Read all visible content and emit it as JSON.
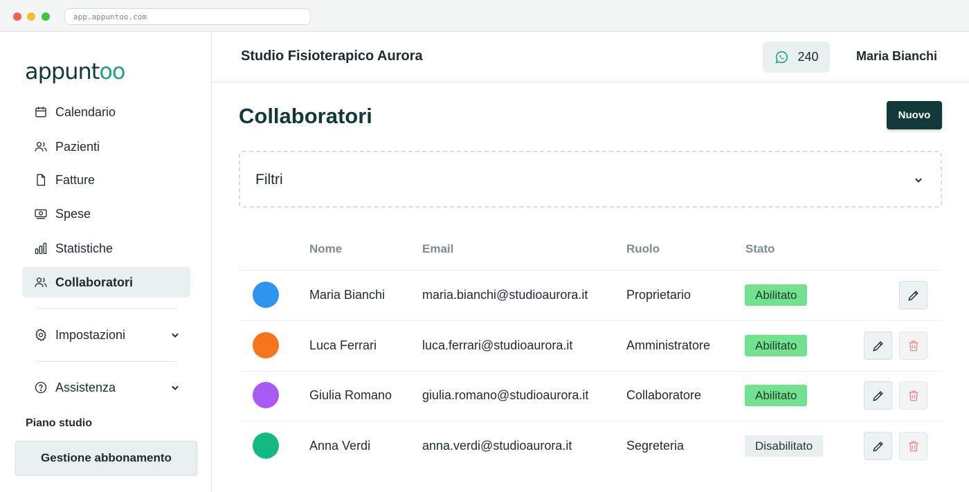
{
  "browser": {
    "url": "app.appuntoo.com"
  },
  "brand": {
    "logo_prefix": "appunt",
    "logo_suffix": "oo",
    "accent": "#1aa877",
    "dark": "#12393a"
  },
  "sidebar": {
    "items": [
      {
        "label": "Calendario",
        "icon": "calendar-icon"
      },
      {
        "label": "Pazienti",
        "icon": "users-icon"
      },
      {
        "label": "Fatture",
        "icon": "document-icon"
      },
      {
        "label": "Spese",
        "icon": "banknote-icon"
      },
      {
        "label": "Statistiche",
        "icon": "bar-chart-icon"
      },
      {
        "label": "Collaboratori",
        "icon": "users-icon",
        "active": true
      }
    ],
    "settings": {
      "label": "Impostazioni",
      "icon": "gear-icon"
    },
    "help": {
      "label": "Assistenza",
      "icon": "help-circle-icon"
    },
    "plan_label": "Piano studio",
    "plan_button": "Gestione abbonamento"
  },
  "header": {
    "studio_name": "Studio Fisioterapico Aurora",
    "whatsapp_count": "240",
    "user_name": "Maria Bianchi"
  },
  "main": {
    "title": "Collaboratori",
    "new_button": "Nuovo",
    "filters_label": "Filtri"
  },
  "table": {
    "headers": {
      "name": "Nome",
      "email": "Email",
      "role": "Ruolo",
      "status": "Stato"
    },
    "rows": [
      {
        "name": "Maria Bianchi",
        "email": "maria.bianchi@studioaurora.it",
        "role": "Proprietario",
        "status": "Abilitato",
        "enabled": true,
        "avatar_color": "#2d94f0",
        "can_delete": false
      },
      {
        "name": "Luca Ferrari",
        "email": "luca.ferrari@studioaurora.it",
        "role": "Amministratore",
        "status": "Abilitato",
        "enabled": true,
        "avatar_color": "#f7761d",
        "can_delete": true
      },
      {
        "name": "Giulia Romano",
        "email": "giulia.romano@studioaurora.it",
        "role": "Collaboratore",
        "status": "Abilitato",
        "enabled": true,
        "avatar_color": "#a95af5",
        "can_delete": true
      },
      {
        "name": "Anna Verdi",
        "email": "anna.verdi@studioaurora.it",
        "role": "Segreteria",
        "status": "Disabilitato",
        "enabled": false,
        "avatar_color": "#12b981",
        "can_delete": true
      }
    ]
  }
}
